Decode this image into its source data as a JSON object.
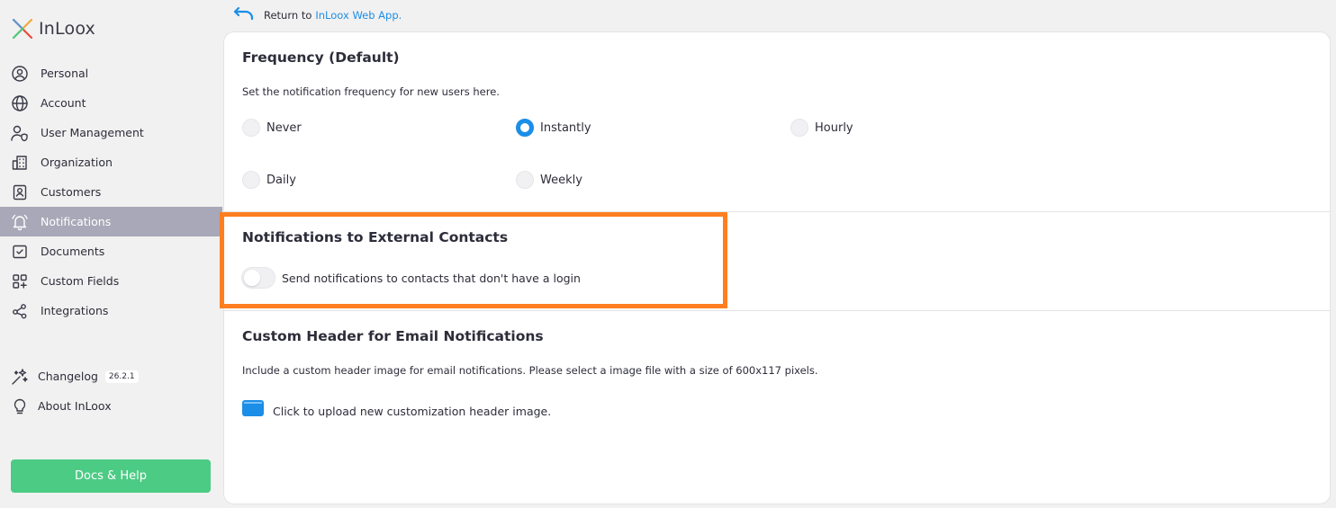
{
  "brand": {
    "name": "InLoox"
  },
  "sidebar": {
    "items": [
      {
        "label": "Personal",
        "icon": "user-circle-icon"
      },
      {
        "label": "Account",
        "icon": "globe-icon"
      },
      {
        "label": "User Management",
        "icon": "user-shield-icon"
      },
      {
        "label": "Organization",
        "icon": "building-icon"
      },
      {
        "label": "Customers",
        "icon": "contact-card-icon"
      },
      {
        "label": "Notifications",
        "icon": "bell-icon",
        "active": true
      },
      {
        "label": "Documents",
        "icon": "document-check-icon"
      },
      {
        "label": "Custom Fields",
        "icon": "grid-plus-icon"
      },
      {
        "label": "Integrations",
        "icon": "share-nodes-icon"
      }
    ],
    "bottom": [
      {
        "label": "Changelog",
        "badge": "26.2.1",
        "icon": "sparkle-icon"
      },
      {
        "label": "About InLoox",
        "icon": "lightbulb-icon"
      }
    ],
    "docs_button": "Docs & Help"
  },
  "return_link": {
    "prefix": "Return to",
    "link": "InLoox Web App."
  },
  "frequency": {
    "title": "Frequency (Default)",
    "description": "Set the notification frequency for new users here.",
    "options": [
      "Never",
      "Instantly",
      "Hourly",
      "Daily",
      "Weekly"
    ],
    "selected": "Instantly"
  },
  "external": {
    "title": "Notifications to External Contacts",
    "toggle_label": "Send notifications to contacts that don't have a login",
    "enabled": false
  },
  "custom_header": {
    "title": "Custom Header for Email Notifications",
    "description": "Include a custom header image for email notifications. Please select a image file with a size of 600x117 pixels.",
    "upload_label": "Click to upload new customization header image."
  },
  "colors": {
    "accent": "#1b8ee8",
    "highlight": "#ff7e1f",
    "docs_button": "#4ccb84",
    "active_nav": "#a8a8b8"
  }
}
